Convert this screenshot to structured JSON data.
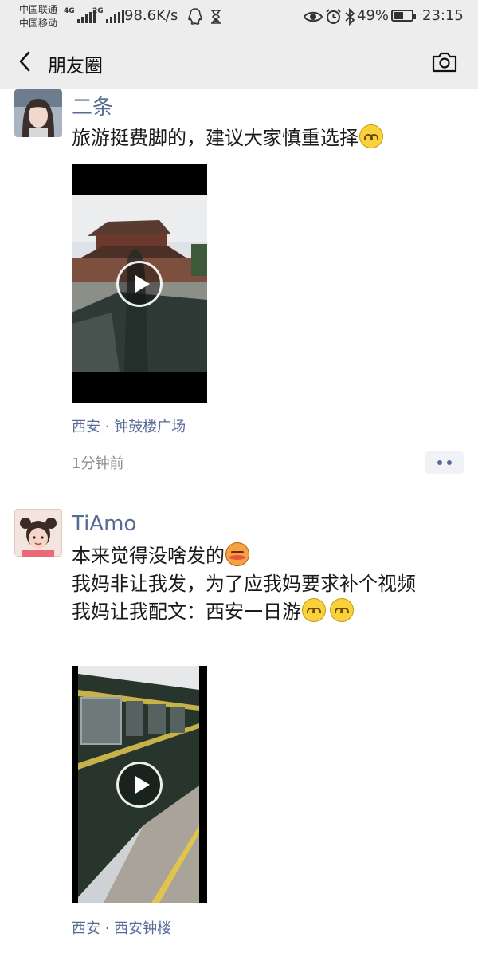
{
  "status_bar": {
    "carrier_1": "中国联通",
    "carrier_2": "中国移动",
    "net_1": "4G",
    "net_2": "2G",
    "net_speed": "98.6K/s",
    "battery": "49%",
    "battery_level": 0.49,
    "time": "23:15"
  },
  "header": {
    "title": "朋友圈",
    "back_icon": "back-arrow-icon",
    "camera_icon": "camera-icon"
  },
  "posts": [
    {
      "name": "二条",
      "text": "旅游挺费脚的，建议大家慎重选择",
      "emojis": [
        "smile"
      ],
      "location": "西安 · 钟鼓楼广场",
      "time": "1分钟前"
    },
    {
      "name": "TiAmo",
      "lines": [
        "本来觉得没啥发的",
        "我妈非让我发，为了应我妈要求补个视频",
        "我妈让我配文：西安一日游"
      ],
      "emojis": [
        "awkward",
        "smile",
        "smile"
      ],
      "location": "西安 · 西安钟楼"
    }
  ],
  "colors": {
    "name": "#576b95",
    "bar": "#ededed",
    "time": "#8c8c8c"
  }
}
